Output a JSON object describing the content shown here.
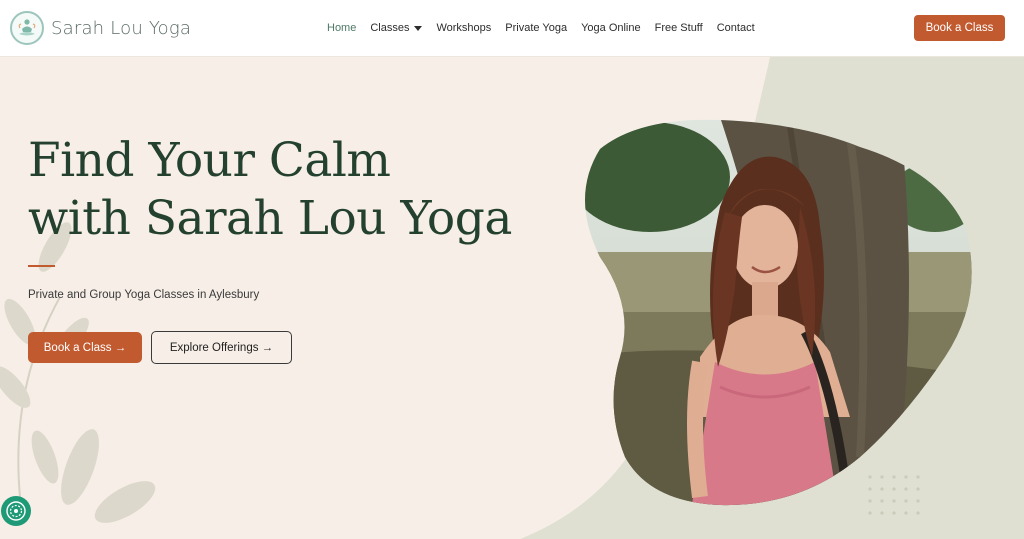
{
  "brand": {
    "name": "Sarah Lou Yoga",
    "logo_icon": "meditation-figure-icon"
  },
  "nav": {
    "items": [
      {
        "label": "Home",
        "active": true
      },
      {
        "label": "Classes",
        "has_dropdown": true
      },
      {
        "label": "Workshops"
      },
      {
        "label": "Private Yoga"
      },
      {
        "label": "Yoga Online"
      },
      {
        "label": "Free Stuff"
      },
      {
        "label": "Contact"
      }
    ],
    "cta_label": "Book a Class"
  },
  "hero": {
    "headline_line1": "Find Your Calm",
    "headline_line2": "with Sarah Lou Yoga",
    "subtitle": "Private and Group Yoga Classes in Aylesbury",
    "primary_button": "Book a Class →",
    "secondary_button": "Explore Offerings →",
    "photo_icon": "woman-by-tree-photo"
  },
  "colors": {
    "accent": "#c25a2f",
    "heading": "#24412f",
    "background": "#f7efe7",
    "sage": "#dfe0d2",
    "active_nav": "#4f7a66",
    "accessibility": "#1f9a76"
  },
  "accessibility": {
    "icon": "accessibility-icon"
  }
}
